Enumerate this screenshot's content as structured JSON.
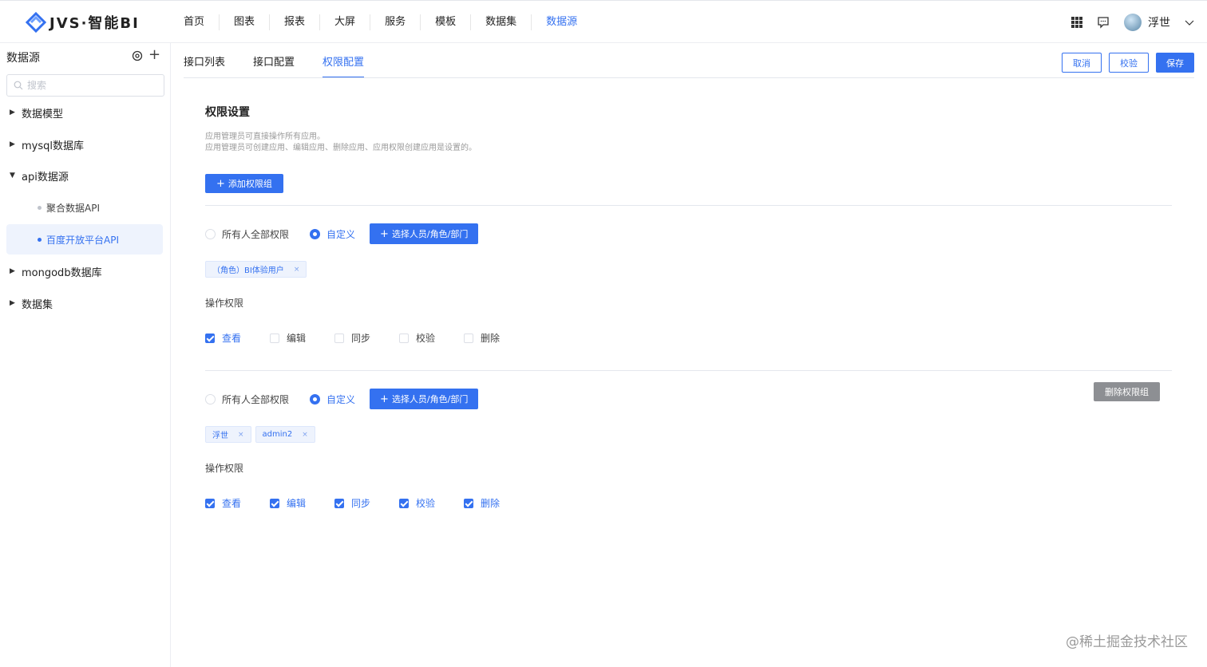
{
  "header": {
    "logo_text": "JVS·智能BI",
    "nav": [
      "首页",
      "图表",
      "报表",
      "大屏",
      "服务",
      "模板",
      "数据集",
      "数据源"
    ],
    "active_nav": "数据源",
    "user_name": "浮世",
    "accent_color": "#3471f0"
  },
  "sidebar": {
    "title": "数据源",
    "search_placeholder": "搜索",
    "tree": {
      "item0": "数据模型",
      "item1": "mysql数据库",
      "item2": "api数据源",
      "child0": "聚合数据API",
      "child1": "百度开放平台API",
      "item3": "mongodb数据库",
      "item4": "数据集"
    },
    "selected": "百度开放平台API"
  },
  "tabs": [
    "接口列表",
    "接口配置",
    "权限配置"
  ],
  "active_tab": "权限配置",
  "actions": {
    "cancel": "取消",
    "verify": "校验",
    "save": "保存"
  },
  "permission": {
    "title": "权限设置",
    "desc_line1": "应用管理员可直接操作所有应用。",
    "desc_line2": "应用管理员可创建应用、编辑应用、删除应用、应用权限创建应用是设置的。",
    "add_group_label": "添加权限组",
    "radio_all": "所有人全部权限",
    "radio_custom": "自定义",
    "select_label": "选择人员/角色/部门",
    "ops_label": "操作权限",
    "ops": [
      "查看",
      "编辑",
      "同步",
      "校验",
      "删除"
    ],
    "delete_group_label": "删除权限组",
    "groups": [
      {
        "mode": "自定义",
        "tags": [
          "（角色）BI体验用户"
        ],
        "checked": [
          true,
          false,
          false,
          false,
          false
        ]
      },
      {
        "mode": "自定义",
        "tags": [
          "浮世",
          "admin2"
        ],
        "checked": [
          true,
          true,
          true,
          true,
          true
        ]
      }
    ]
  },
  "watermark": "@稀土掘金技术社区"
}
